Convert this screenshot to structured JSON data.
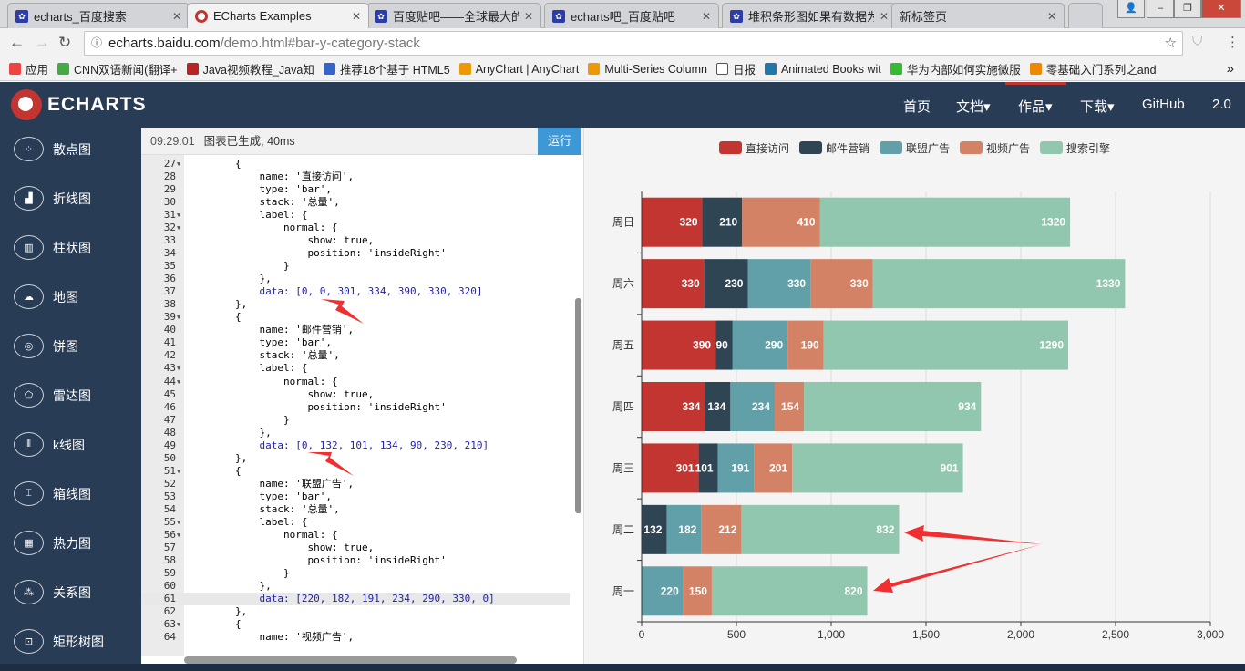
{
  "browser": {
    "tabs": [
      {
        "title": "echarts_百度搜索",
        "active": false
      },
      {
        "title": "ECharts Examples",
        "active": true
      },
      {
        "title": "百度贴吧——全球最大的",
        "active": false
      },
      {
        "title": "echarts吧_百度贴吧",
        "active": false
      },
      {
        "title": "堆积条形图如果有数据为",
        "active": false
      },
      {
        "title": "新标签页",
        "active": false
      }
    ],
    "url_host": "echarts.baidu.com",
    "url_path": "/demo.html#bar-y-category-stack",
    "bookmarks": [
      "应用",
      "CNN双语新闻(翻译+",
      "Java视频教程_Java知",
      "推荐18个基于 HTML5",
      "AnyChart | AnyChart",
      "Multi-Series Column",
      "日报",
      "Animated Books wit",
      "华为内部如何实施微服",
      "零基础入门系列之and"
    ],
    "bookmarks_more": "»"
  },
  "site": {
    "logo": "ECHARTS",
    "nav": [
      {
        "label": "首页"
      },
      {
        "label": "文档▾"
      },
      {
        "label": "作品▾",
        "active": true
      },
      {
        "label": "下载▾"
      },
      {
        "label": "GitHub"
      },
      {
        "label": "2.0"
      }
    ],
    "accent": "#c23531"
  },
  "sidebar": {
    "items": [
      {
        "label": "散点图",
        "icon": "scatter-icon"
      },
      {
        "label": "折线图",
        "icon": "line-icon"
      },
      {
        "label": "柱状图",
        "icon": "bar-icon"
      },
      {
        "label": "地图",
        "icon": "map-icon"
      },
      {
        "label": "饼图",
        "icon": "pie-icon"
      },
      {
        "label": "雷达图",
        "icon": "radar-icon"
      },
      {
        "label": "k线图",
        "icon": "candlestick-icon"
      },
      {
        "label": "箱线图",
        "icon": "boxplot-icon"
      },
      {
        "label": "热力图",
        "icon": "heatmap-icon"
      },
      {
        "label": "关系图",
        "icon": "graph-icon"
      },
      {
        "label": "矩形树图",
        "icon": "treemap-icon"
      }
    ]
  },
  "editor": {
    "time": "09:29:01",
    "status": "图表已生成, 40ms",
    "run_label": "运行",
    "first_line": 27,
    "highlight_line": 61,
    "fold_lines": [
      27,
      31,
      32,
      39,
      43,
      44,
      51,
      55,
      56,
      63
    ],
    "lines": [
      "        {",
      "            name: '直接访问',",
      "            type: 'bar',",
      "            stack: '总量',",
      "            label: {",
      "                normal: {",
      "                    show: true,",
      "                    position: 'insideRight'",
      "                }",
      "            },",
      "            data: [0, 0, 301, 334, 390, 330, 320]",
      "        },",
      "        {",
      "            name: '邮件营销',",
      "            type: 'bar',",
      "            stack: '总量',",
      "            label: {",
      "                normal: {",
      "                    show: true,",
      "                    position: 'insideRight'",
      "                }",
      "            },",
      "            data: [0, 132, 101, 134, 90, 230, 210]",
      "        },",
      "        {",
      "            name: '联盟广告',",
      "            type: 'bar',",
      "            stack: '总量',",
      "            label: {",
      "                normal: {",
      "                    show: true,",
      "                    position: 'insideRight'",
      "                }",
      "            },",
      "            data: [220, 182, 191, 234, 290, 330, 0]",
      "        },",
      "        {",
      "            name: '视频广告',"
    ]
  },
  "chart_data": {
    "type": "bar",
    "orientation": "horizontal",
    "stacked": true,
    "categories": [
      "周一",
      "周二",
      "周三",
      "周四",
      "周五",
      "周六",
      "周日"
    ],
    "series": [
      {
        "name": "直接访问",
        "color": "#c23531",
        "values": [
          0,
          0,
          301,
          334,
          390,
          330,
          320
        ]
      },
      {
        "name": "邮件营销",
        "color": "#2f4554",
        "values": [
          0,
          132,
          101,
          134,
          90,
          230,
          210
        ]
      },
      {
        "name": "联盟广告",
        "color": "#61a0a8",
        "values": [
          220,
          182,
          191,
          234,
          290,
          330,
          0
        ]
      },
      {
        "name": "视频广告",
        "color": "#d48265",
        "values": [
          150,
          212,
          201,
          154,
          190,
          330,
          410
        ]
      },
      {
        "name": "搜索引擎",
        "color": "#91c7ae",
        "values": [
          820,
          832,
          901,
          934,
          1290,
          1330,
          1320
        ]
      }
    ],
    "xlim": [
      0,
      3000
    ],
    "xticks": [
      0,
      500,
      1000,
      1500,
      2000,
      2500,
      3000
    ],
    "xtick_labels": [
      "0",
      "500",
      "1,000",
      "1,500",
      "2,000",
      "2,500",
      "3,000"
    ],
    "grid": "vertical",
    "legend": "top",
    "data_labels": "insideRight, hidden for zero values"
  },
  "annotations": {
    "arrows": "red",
    "color": "#f03030"
  }
}
